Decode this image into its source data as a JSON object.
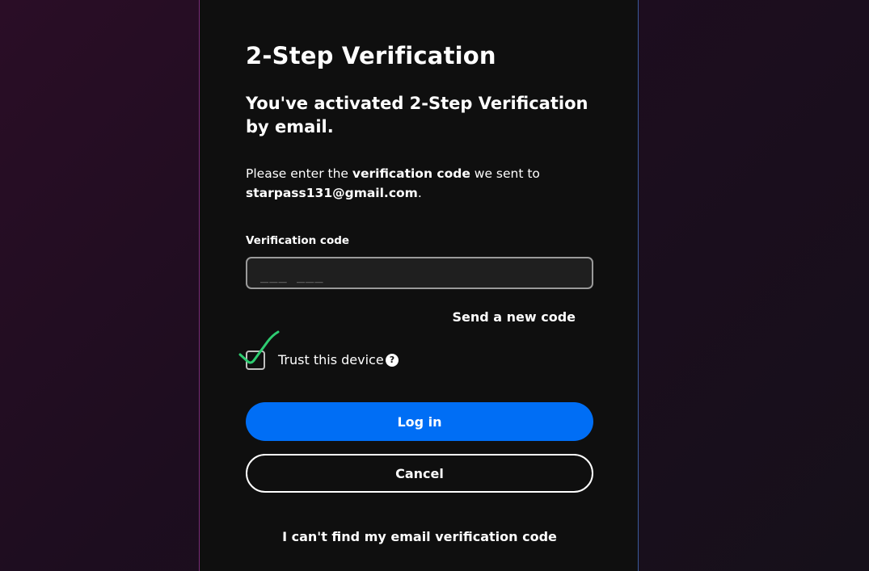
{
  "page": {
    "title": "2-Step Verification",
    "subtitle": "You've activated 2-Step Verification by email.",
    "instructions": {
      "prefix": "Please enter the ",
      "emphasis": "verification code",
      "middle": " we sent to ",
      "email": "starpass131@gmail.com",
      "suffix": "."
    }
  },
  "form": {
    "code_label": "Verification code",
    "code_value": "",
    "code_placeholder": "___ ___",
    "send_new_code": "Send a new code",
    "trust_device_label": "Trust this device",
    "trust_device_checked": true,
    "help_icon_glyph": "?",
    "help_icon_name": "question-circle-icon",
    "checkmark_color": "#2ecc71",
    "login_label": "Log in",
    "cancel_label": "Cancel",
    "cant_find_label": "I can't find my email verification code"
  },
  "colors": {
    "primary_button": "#006ef5",
    "card_background": "#0f0f0f"
  }
}
